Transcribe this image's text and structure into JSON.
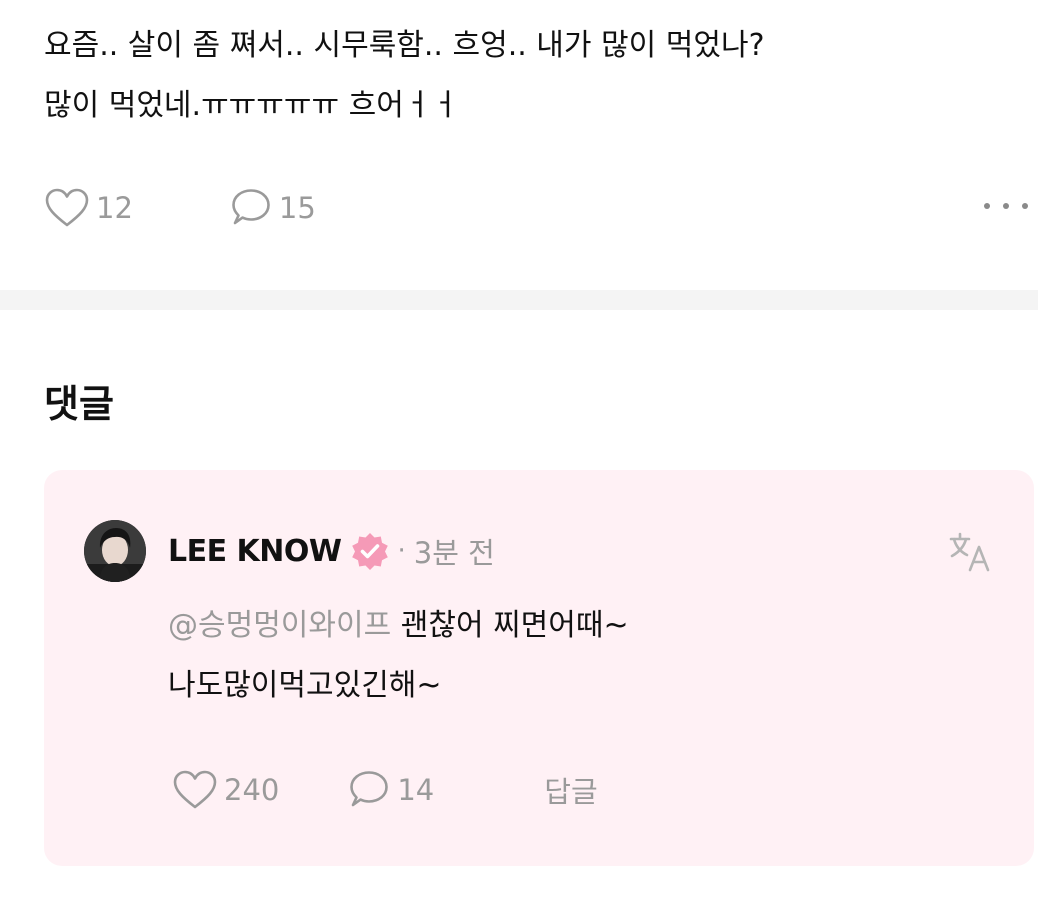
{
  "post": {
    "lines": [
      "요즘.. 살이 좀 쪄서.. 시무룩함.. 흐엉.. 내가 많이 먹었나?",
      "많이 먹었네.ㅠㅠㅠㅠㅠ 흐어ㅓㅓ"
    ],
    "like_count": "12",
    "comment_count": "15"
  },
  "comments_section": {
    "title": "댓글",
    "comment": {
      "author": "LEE KNOW",
      "separator": "·",
      "time_ago": "3분 전",
      "mention": "@승멍멍이와이프",
      "text_line1_rest": " 괜찮어 찌면어때~",
      "text_line2": "나도많이먹고있긴해~",
      "like_count": "240",
      "reply_count": "14",
      "reply_label": "답글"
    }
  },
  "colors": {
    "comment_background": "#fff1f5",
    "verified_badge": "#f59ab7",
    "muted_text": "#9a9a9a",
    "divider": "#f4f4f4"
  },
  "icons": {
    "like": "heart-outline-icon",
    "comment": "speech-bubble-icon",
    "more": "more-dots-icon",
    "verified": "verified-badge-icon",
    "translate": "translate-icon"
  }
}
